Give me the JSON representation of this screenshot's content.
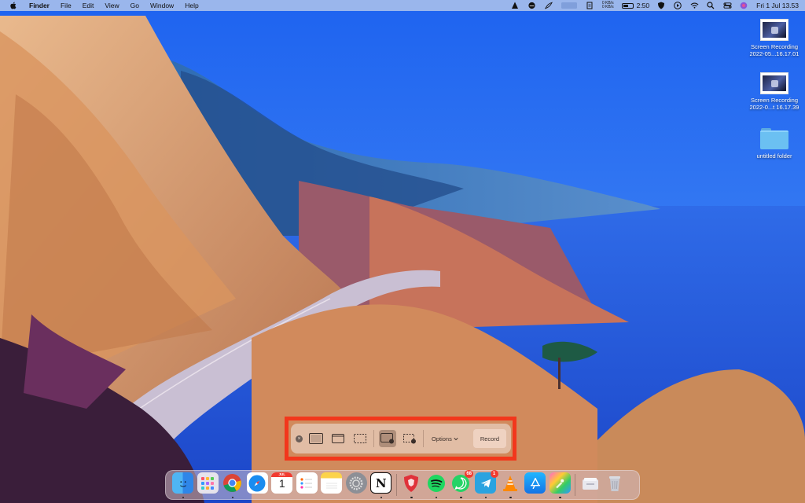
{
  "menubar": {
    "app_name": "Finder",
    "menus": [
      "File",
      "Edit",
      "View",
      "Go",
      "Window",
      "Help"
    ],
    "net_up": "0 KB/s",
    "net_down": "0 KB/s",
    "battery_time": "2:50",
    "datetime": "Fri 1 Jul  13.53"
  },
  "desktop": {
    "items": [
      {
        "line1": "Screen Recording",
        "line2": "2022-05...16.17.01",
        "icon": "video-thumbnail-icon"
      },
      {
        "line1": "Screen Recording",
        "line2": "2022-0...t 16.17.39",
        "icon": "video-thumbnail-icon"
      },
      {
        "line1": "untitled folder",
        "line2": "",
        "icon": "folder-icon"
      }
    ]
  },
  "screenshot_toolbar": {
    "options_label": "Options",
    "record_label": "Record",
    "highlight_color": "#f2371c"
  },
  "dock": {
    "calendar_month": "JUL",
    "calendar_day": "1",
    "whatsapp_badge": "68",
    "telegram_badge": "1"
  }
}
